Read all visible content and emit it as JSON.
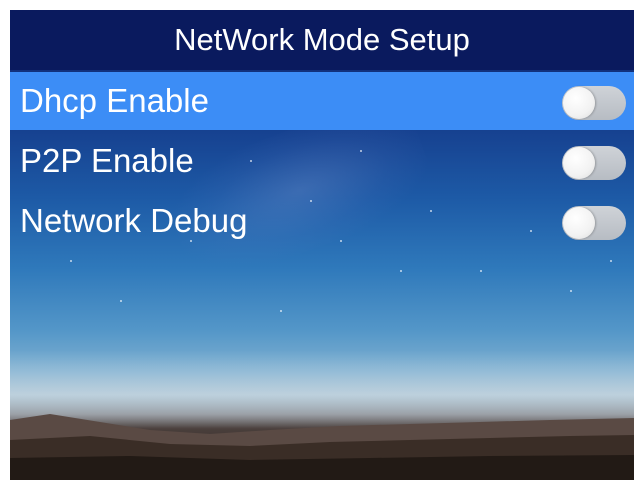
{
  "header": {
    "title": "NetWork Mode Setup"
  },
  "menu": {
    "items": [
      {
        "label": "Dhcp Enable",
        "enabled": false,
        "selected": true
      },
      {
        "label": "P2P Enable",
        "enabled": false,
        "selected": false
      },
      {
        "label": "Network Debug",
        "enabled": false,
        "selected": false
      }
    ]
  },
  "colors": {
    "title_bar": "#0a1a5e",
    "selected_row": "#3c8df6",
    "toggle_off": "#c4c8ce",
    "text": "#ffffff"
  },
  "background": {
    "icon": "night-sky-landscape-wallpaper"
  }
}
